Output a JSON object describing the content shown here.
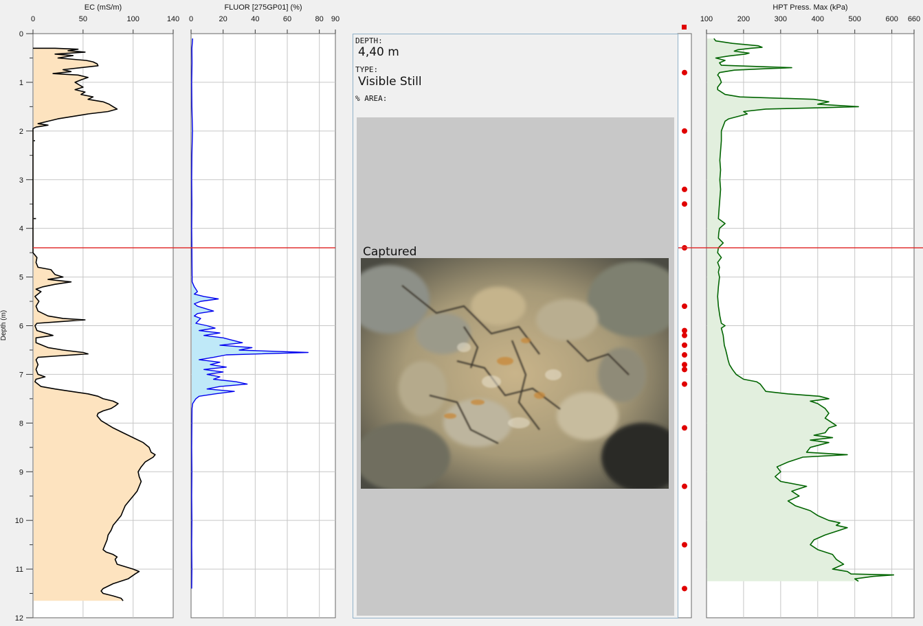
{
  "depth_axis": {
    "label": "Depth (m)",
    "ticks": [
      "0",
      "1",
      "2",
      "3",
      "4",
      "5",
      "6",
      "7",
      "8",
      "9",
      "10",
      "11",
      "12"
    ],
    "range": [
      0,
      12
    ]
  },
  "current_depth": 4.4,
  "viewer": {
    "depth_label": "DEPTH:",
    "depth_value": "4,40 m",
    "type_label": "TYPE:",
    "type_value": "Visible Still",
    "area_label": "% AREA:",
    "captured_label": "Captured"
  },
  "image_markers": [
    4.4
  ],
  "colors": {
    "ec_fill": "#fde3bf",
    "fluor_fill": "#bfe9f8",
    "hpt_fill": "#e2efde",
    "ec_line": "#000000",
    "fluor_line": "#0000ee",
    "hpt_line": "#006400",
    "marker": "#e00000",
    "depth_line": "#e03030"
  },
  "chart_data": [
    {
      "type": "line",
      "title": "EC (mS/m)",
      "xlim": [
        0,
        140
      ],
      "xticks": [
        "0",
        "50",
        "100",
        "140"
      ],
      "ylim": [
        0,
        12
      ],
      "series": [
        {
          "x": [],
          "depth": []
        }
      ]
    },
    {
      "type": "line",
      "title": "FLUOR [275GP01] (%)",
      "xlim": [
        0,
        90
      ],
      "xticks": [
        "0",
        "20",
        "40",
        "60",
        "80",
        "90"
      ],
      "ylim": [
        0,
        12
      ],
      "series": [
        {
          "x": [],
          "depth": []
        }
      ]
    },
    {
      "type": "line",
      "title": "HPT Press. Max (kPa)",
      "xlim": [
        100,
        660
      ],
      "xticks": [
        "100",
        "200",
        "300",
        "400",
        "500",
        "600",
        "660"
      ],
      "ylim": [
        0,
        12
      ],
      "series": [
        {
          "x": [],
          "depth": []
        }
      ]
    }
  ]
}
